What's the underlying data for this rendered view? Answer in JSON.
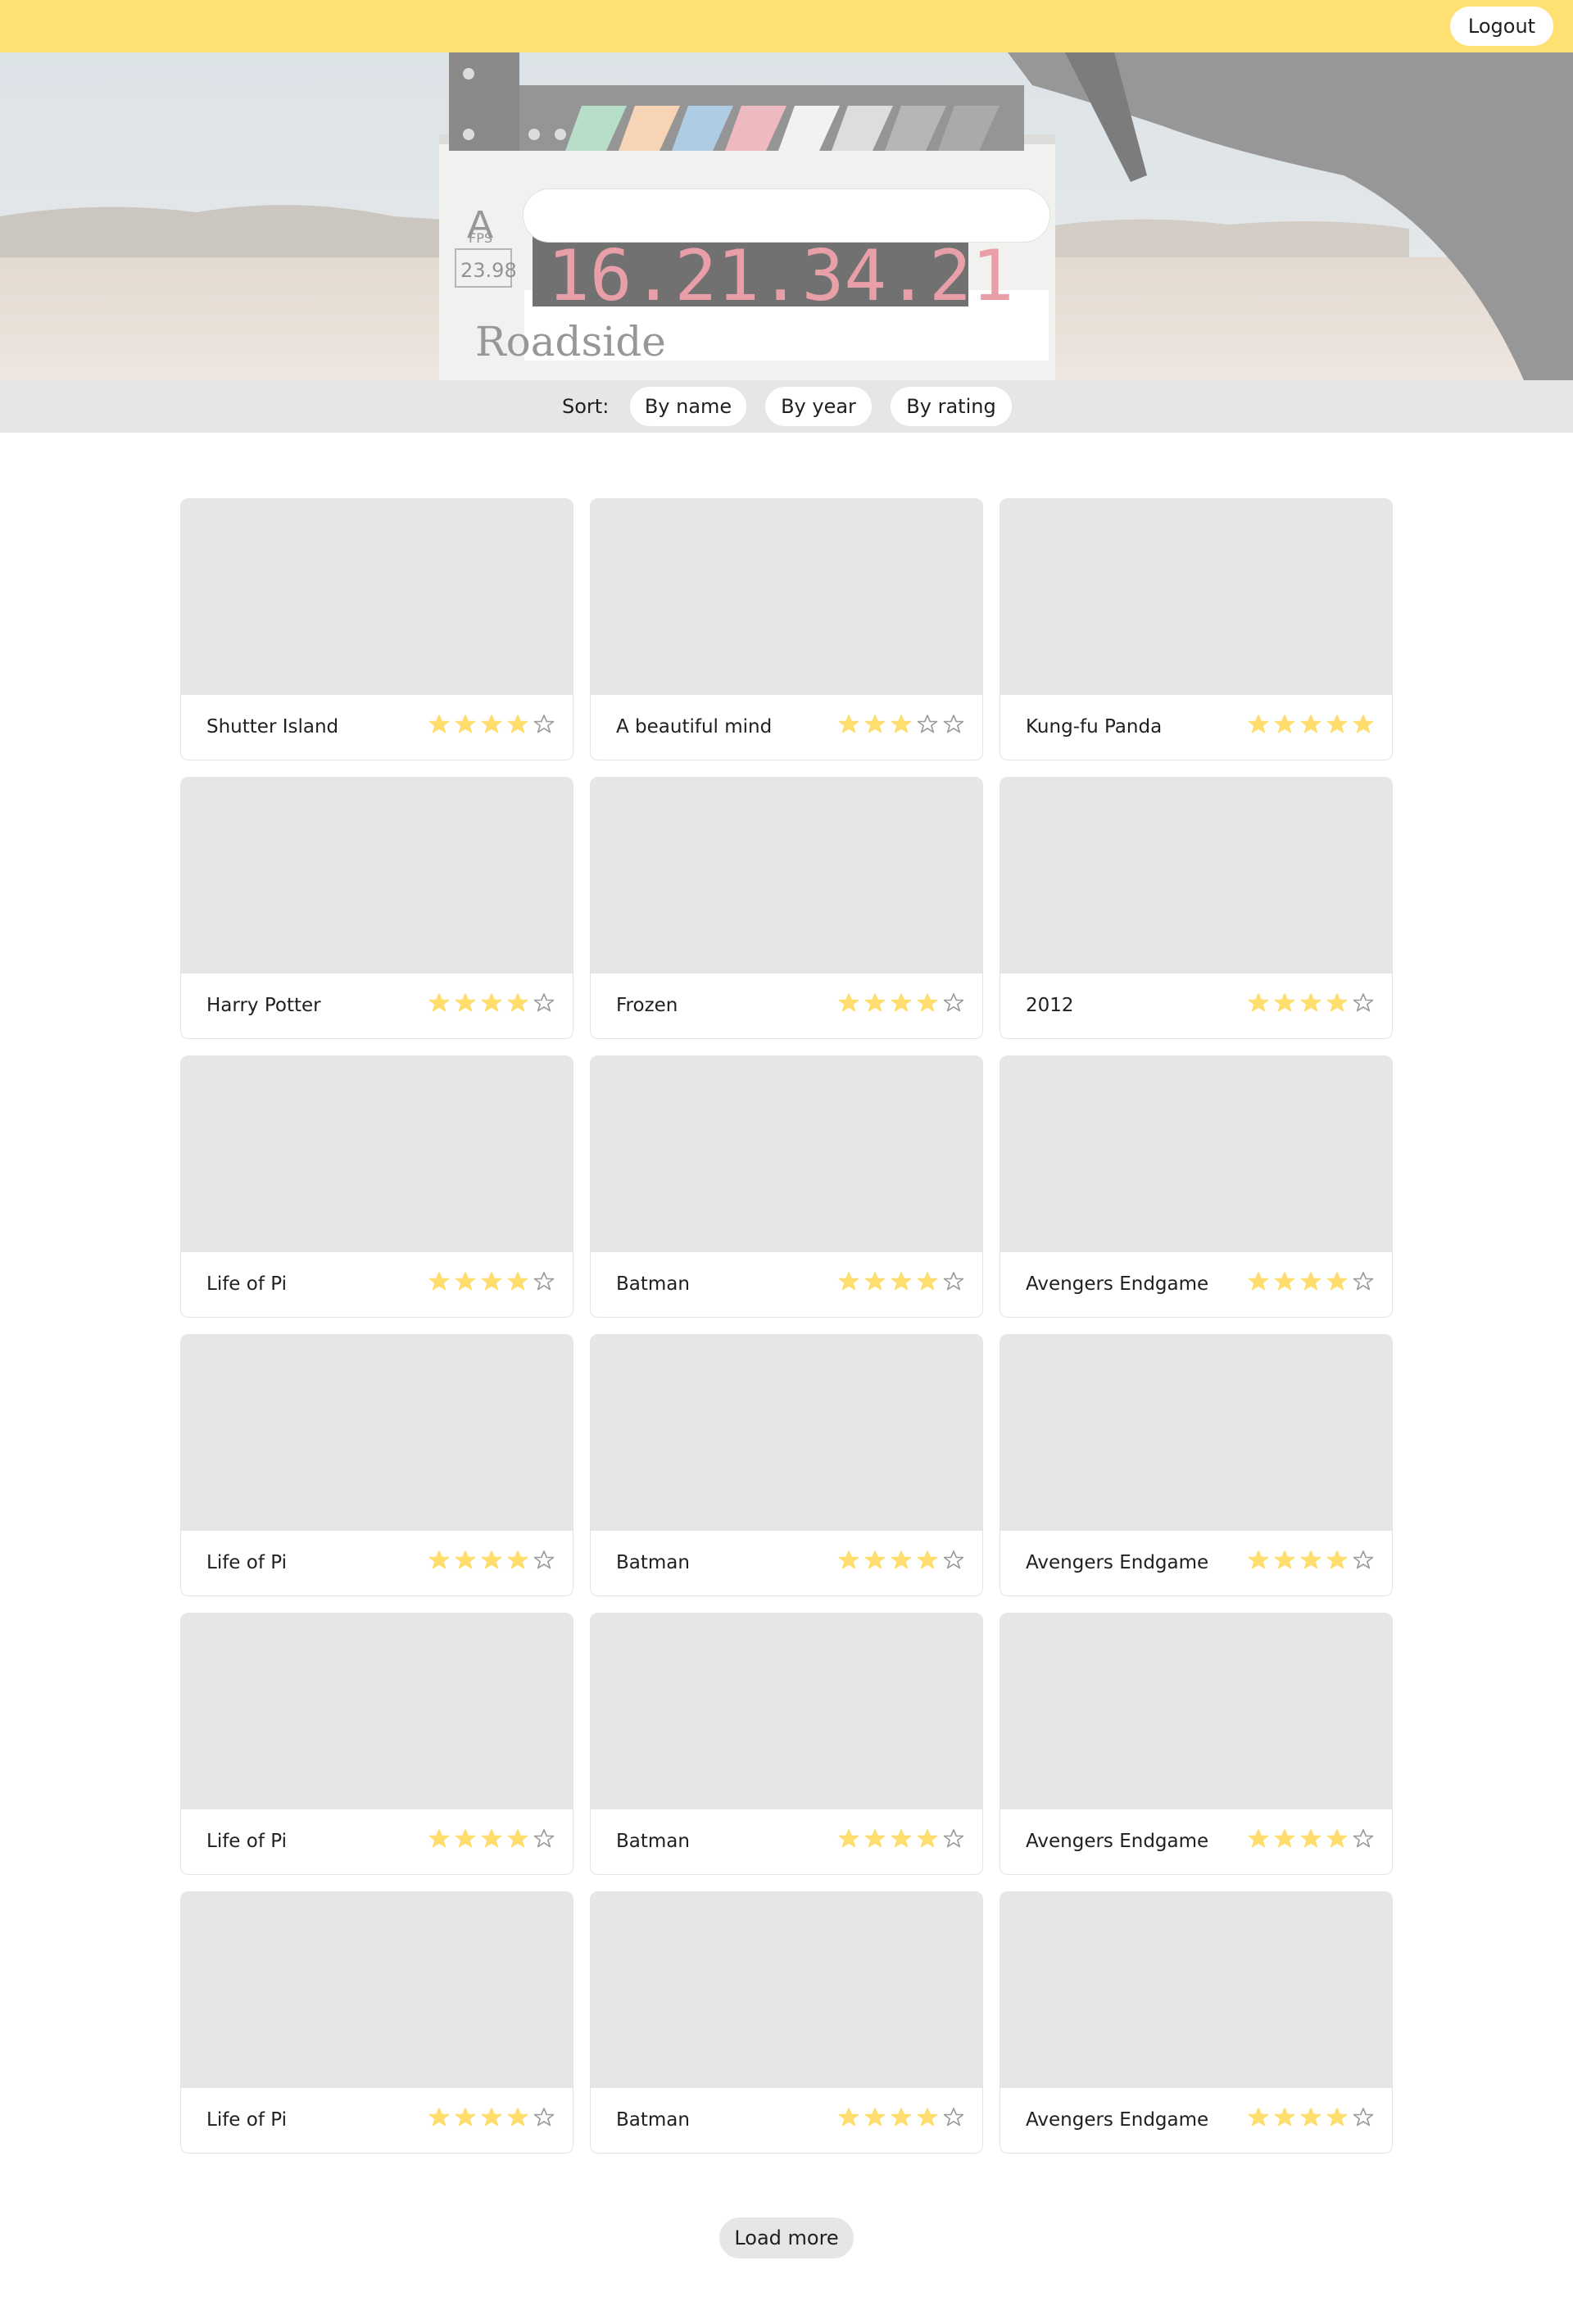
{
  "header": {
    "logout_label": "Logout"
  },
  "hero": {
    "search_placeholder": "",
    "slate_time": "16.21.34.21",
    "slate_fps_label": "FPS",
    "slate_fps_value": "23.98",
    "slate_title": "Roadside",
    "slate_letter": "A"
  },
  "sort": {
    "label": "Sort:",
    "options": [
      "By name",
      "By year",
      "By rating"
    ]
  },
  "movies": [
    {
      "title": "Shutter Island",
      "rating": 4
    },
    {
      "title": "A beautiful mind",
      "rating": 3
    },
    {
      "title": "Kung-fu Panda",
      "rating": 5
    },
    {
      "title": "Harry Potter",
      "rating": 4
    },
    {
      "title": "Frozen",
      "rating": 4
    },
    {
      "title": "2012",
      "rating": 4
    },
    {
      "title": "Life of Pi",
      "rating": 4
    },
    {
      "title": "Batman",
      "rating": 4
    },
    {
      "title": "Avengers Endgame",
      "rating": 4
    },
    {
      "title": "Life of Pi",
      "rating": 4
    },
    {
      "title": "Batman",
      "rating": 4
    },
    {
      "title": "Avengers Endgame",
      "rating": 4
    },
    {
      "title": "Life of Pi",
      "rating": 4
    },
    {
      "title": "Batman",
      "rating": 4
    },
    {
      "title": "Avengers Endgame",
      "rating": 4
    },
    {
      "title": "Life of Pi",
      "rating": 4
    },
    {
      "title": "Batman",
      "rating": 4
    },
    {
      "title": "Avengers Endgame",
      "rating": 4
    }
  ],
  "rating_max": 5,
  "load_more_label": "Load more",
  "colors": {
    "topbar": "#ffe173",
    "star_filled": "#ffde6e",
    "star_empty_stroke": "#9a9a9a",
    "placeholder": "#e6e6e6"
  }
}
